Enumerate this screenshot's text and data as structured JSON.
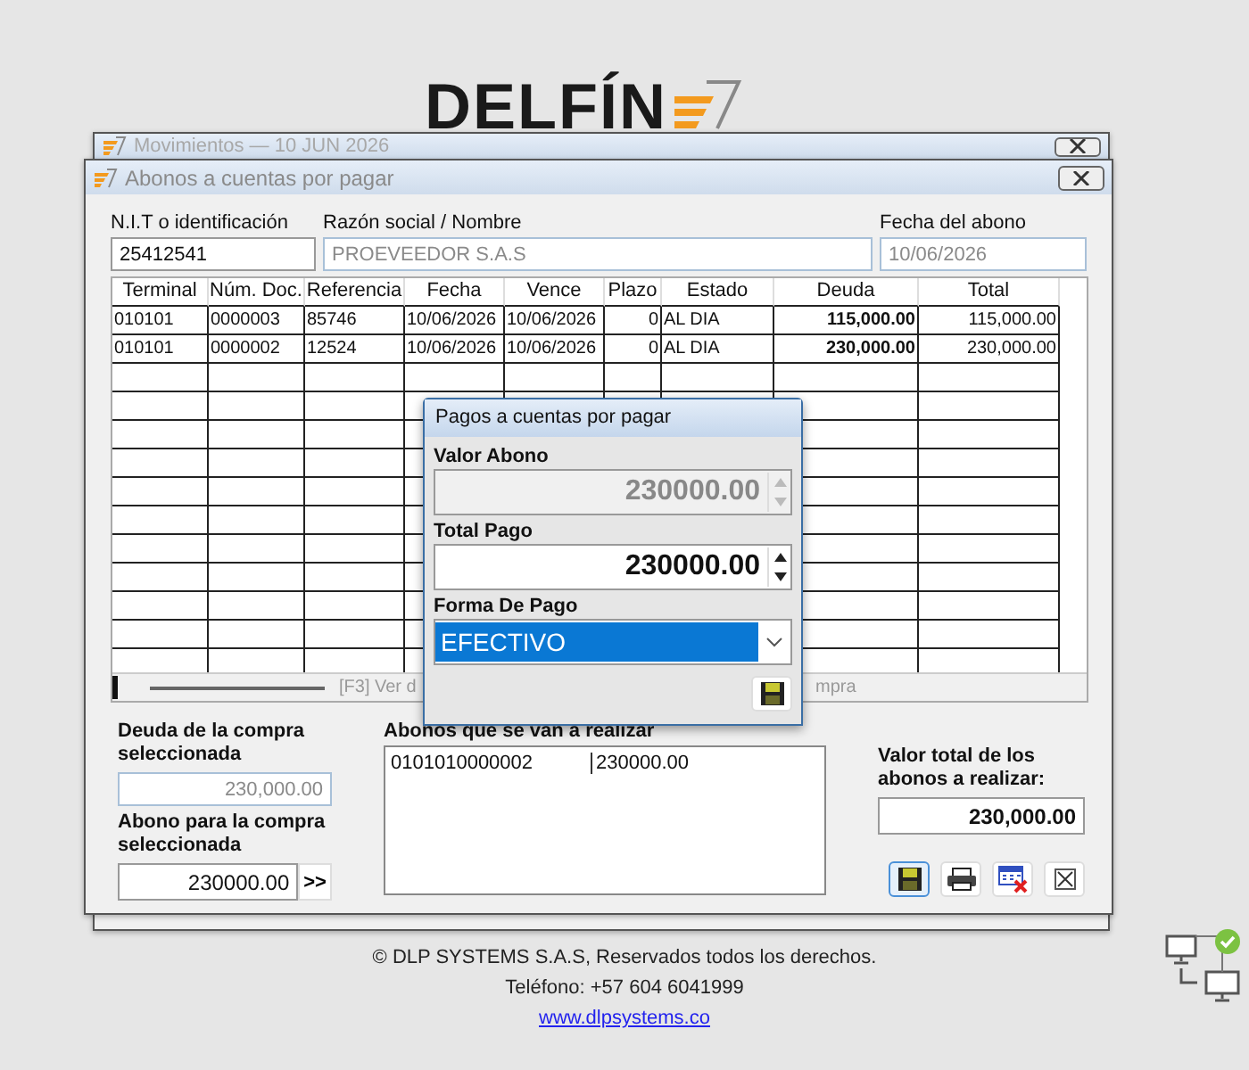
{
  "logo": {
    "text": "DELFÍN"
  },
  "back_window": {
    "title": "Movimientos — 10 JUN 2026"
  },
  "window": {
    "title": "Abonos a cuentas por pagar",
    "fields": [
      {
        "label": "N.I.T o identificación",
        "value": "25412541",
        "disabled": false
      },
      {
        "label": "Razón social / Nombre",
        "value": "PROEVEEDOR S.A.S",
        "disabled": true
      },
      {
        "label": "Fecha del abono",
        "value": "10/06/2026",
        "disabled": true
      }
    ],
    "table": {
      "columns": [
        "Terminal",
        "Núm. Doc.",
        "Referencia",
        "Fecha",
        "Vence",
        "Plazo",
        "Estado",
        "Deuda",
        "Total"
      ],
      "rows": [
        [
          "010101",
          "0000003",
          "85746",
          "10/06/2026",
          "10/06/2026",
          "0",
          "AL DIA",
          "115,000.00",
          "115,000.00"
        ],
        [
          "010101",
          "0000002",
          "12524",
          "10/06/2026",
          "10/06/2026",
          "0",
          "AL DIA",
          "230,000.00",
          "230,000.00"
        ]
      ]
    },
    "status_left": "[F3] Ver d",
    "status_right": "mpra",
    "debt": {
      "label": "Deuda de la compra seleccionada",
      "value": "230,000.00",
      "disabled": true
    },
    "payment": {
      "label": "Abono para la compra seleccionada",
      "value": "230000.00",
      "button": ">>"
    },
    "payments_list": {
      "label": "Abonos que se van a realizar",
      "rows": [
        [
          "0101010000002",
          "230000.00"
        ]
      ]
    },
    "total": {
      "label": "Valor total de los abonos a realizar:",
      "value": "230,000.00"
    }
  },
  "popup": {
    "title": "Pagos a cuentas por pagar",
    "fields": [
      {
        "kind": "spin",
        "label": "Valor Abono",
        "value": "230000.00",
        "disabled": true
      },
      {
        "kind": "spin",
        "label": "Total Pago",
        "value": "230000.00",
        "disabled": false
      },
      {
        "kind": "select",
        "label": "Forma De Pago",
        "value": "EFECTIVO",
        "disabled": false
      }
    ]
  },
  "footer": {
    "copyright": "© DLP SYSTEMS S.A.S, Reservados todos los derechos.",
    "phone": "Teléfono: +57 604 6041999",
    "link": "www.dlpsystems.co"
  }
}
